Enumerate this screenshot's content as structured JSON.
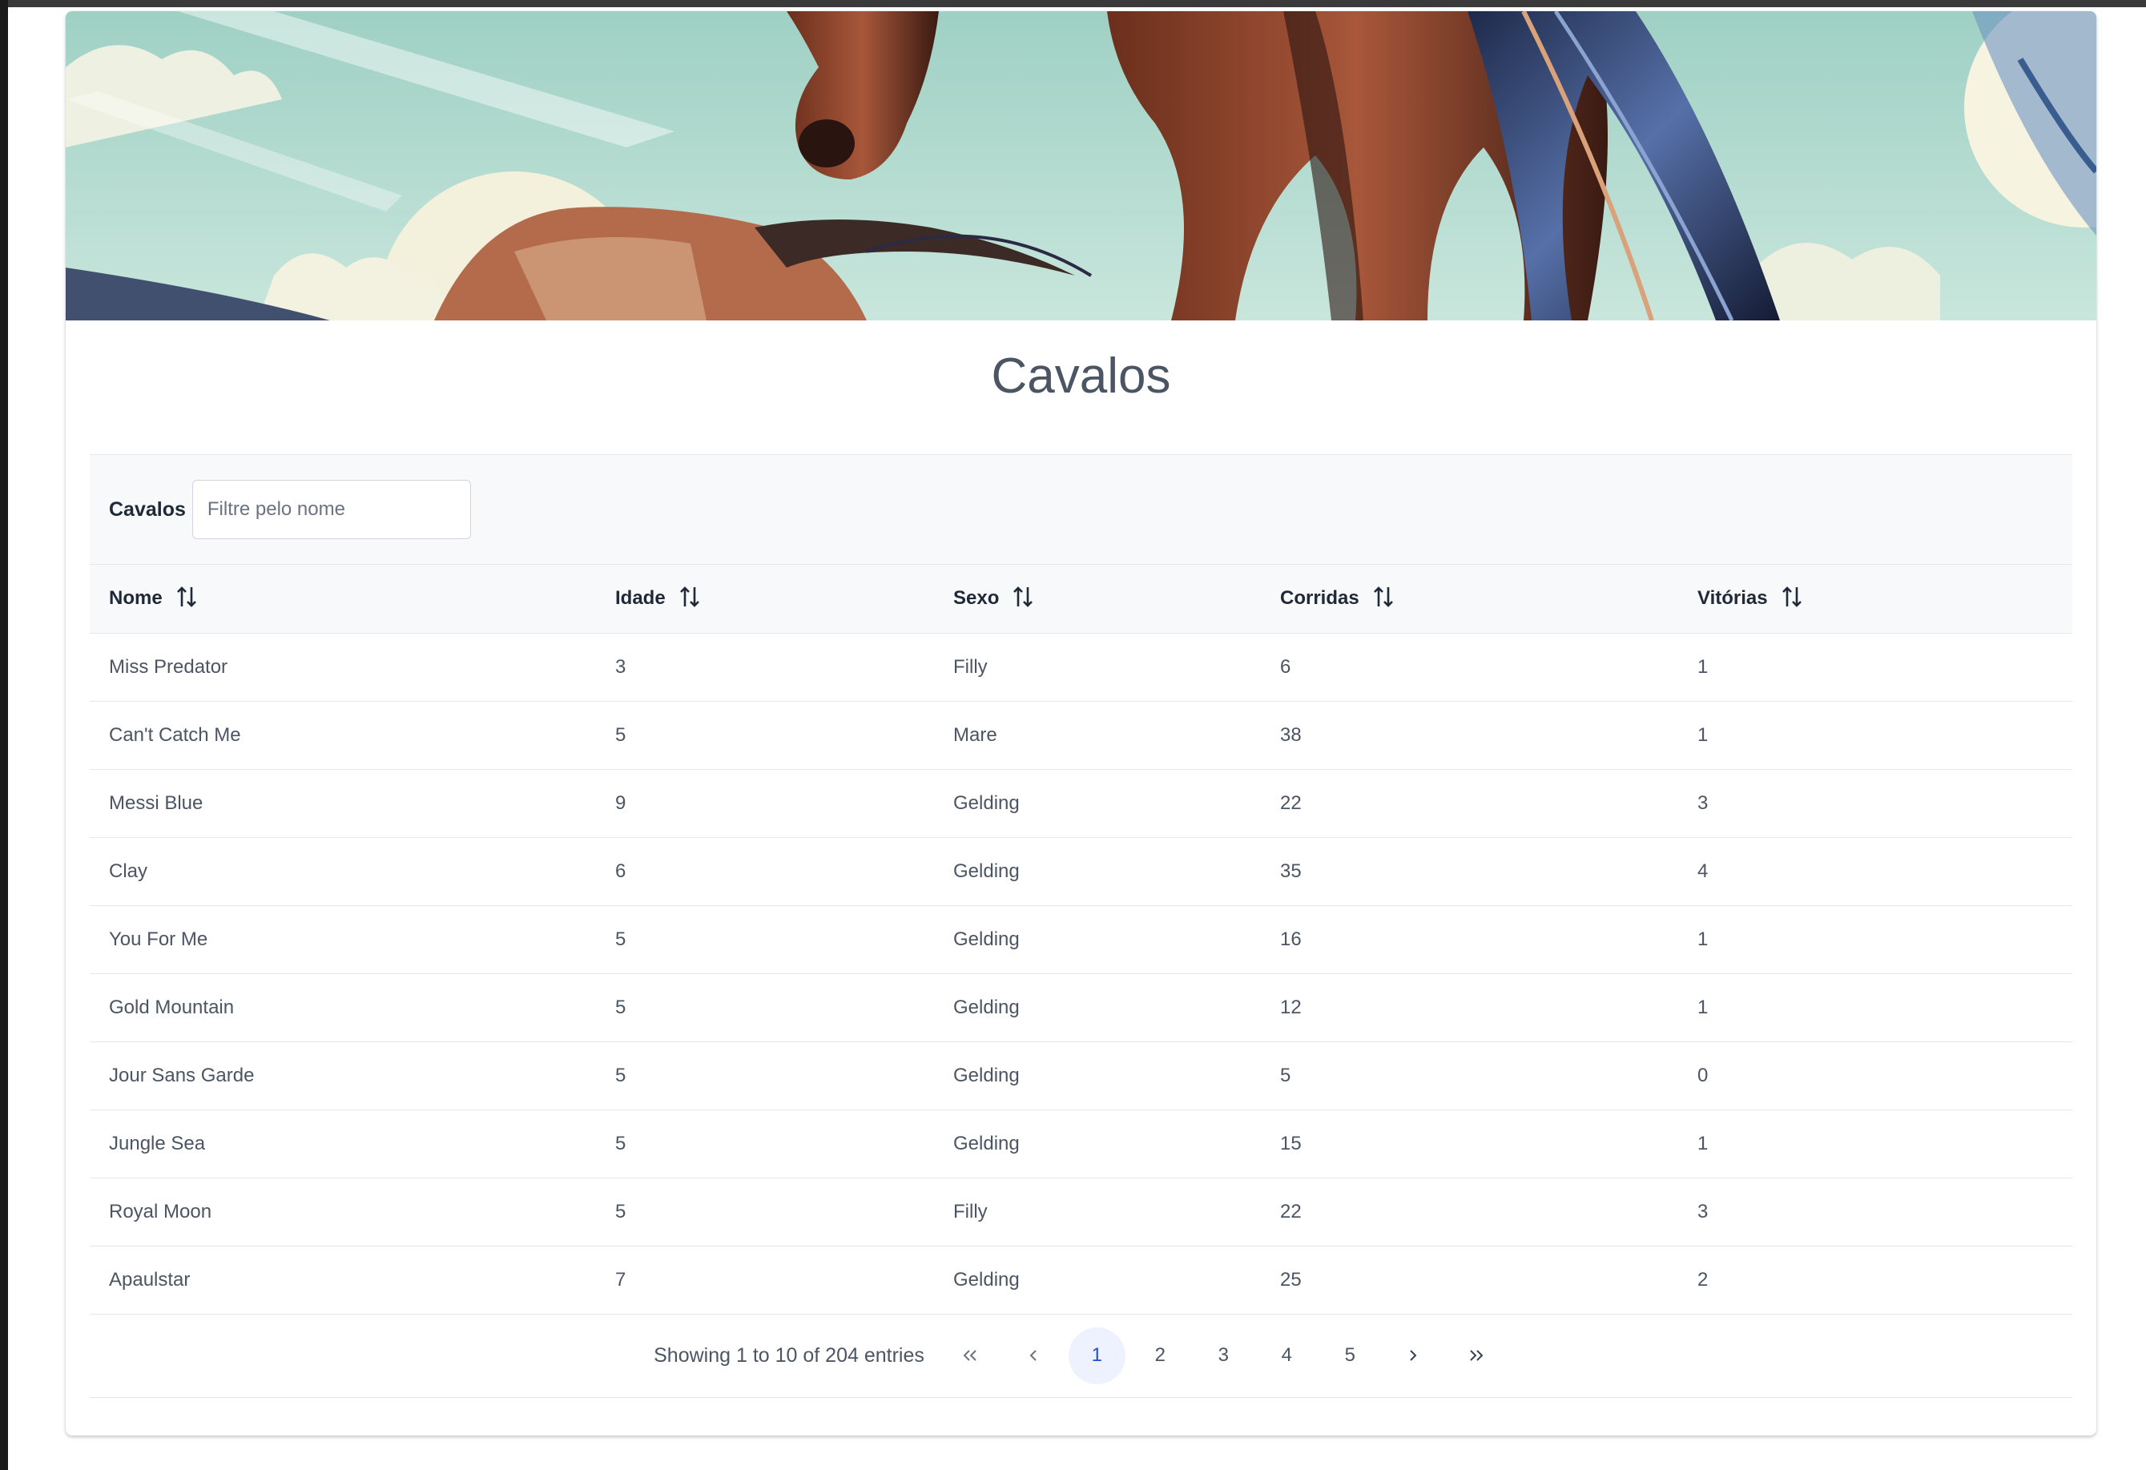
{
  "page": {
    "title": "Cavalos"
  },
  "filter": {
    "label": "Cavalos",
    "placeholder": "Filtre pelo nome",
    "value": ""
  },
  "table": {
    "columns": [
      {
        "label": "Nome",
        "sortable": true
      },
      {
        "label": "Idade",
        "sortable": true
      },
      {
        "label": "Sexo",
        "sortable": true
      },
      {
        "label": "Corridas",
        "sortable": true
      },
      {
        "label": "Vitórias",
        "sortable": true
      }
    ],
    "rows": [
      [
        "Miss Predator",
        "3",
        "Filly",
        "6",
        "1"
      ],
      [
        "Can't Catch Me",
        "5",
        "Mare",
        "38",
        "1"
      ],
      [
        "Messi Blue",
        "9",
        "Gelding",
        "22",
        "3"
      ],
      [
        "Clay",
        "6",
        "Gelding",
        "35",
        "4"
      ],
      [
        "You For Me",
        "5",
        "Gelding",
        "16",
        "1"
      ],
      [
        "Gold Mountain",
        "5",
        "Gelding",
        "12",
        "1"
      ],
      [
        "Jour Sans Garde",
        "5",
        "Gelding",
        "5",
        "0"
      ],
      [
        "Jungle Sea",
        "5",
        "Gelding",
        "15",
        "1"
      ],
      [
        "Royal Moon",
        "5",
        "Filly",
        "22",
        "3"
      ],
      [
        "Apaulstar",
        "7",
        "Gelding",
        "25",
        "2"
      ]
    ]
  },
  "pagination": {
    "report": "Showing 1 to 10 of 204 entries",
    "pages": [
      "1",
      "2",
      "3",
      "4",
      "5"
    ],
    "current": "1",
    "icons": {
      "first": "double-chevron-left-icon",
      "prev": "chevron-left-icon",
      "next": "chevron-right-icon",
      "last": "double-chevron-right-icon"
    }
  },
  "banner": {
    "description_icon": "horse-illustration"
  },
  "colors": {
    "accent": "#1d4ed8",
    "active_page_bg": "#eef2ff",
    "header_bg": "#f8f9fa"
  }
}
